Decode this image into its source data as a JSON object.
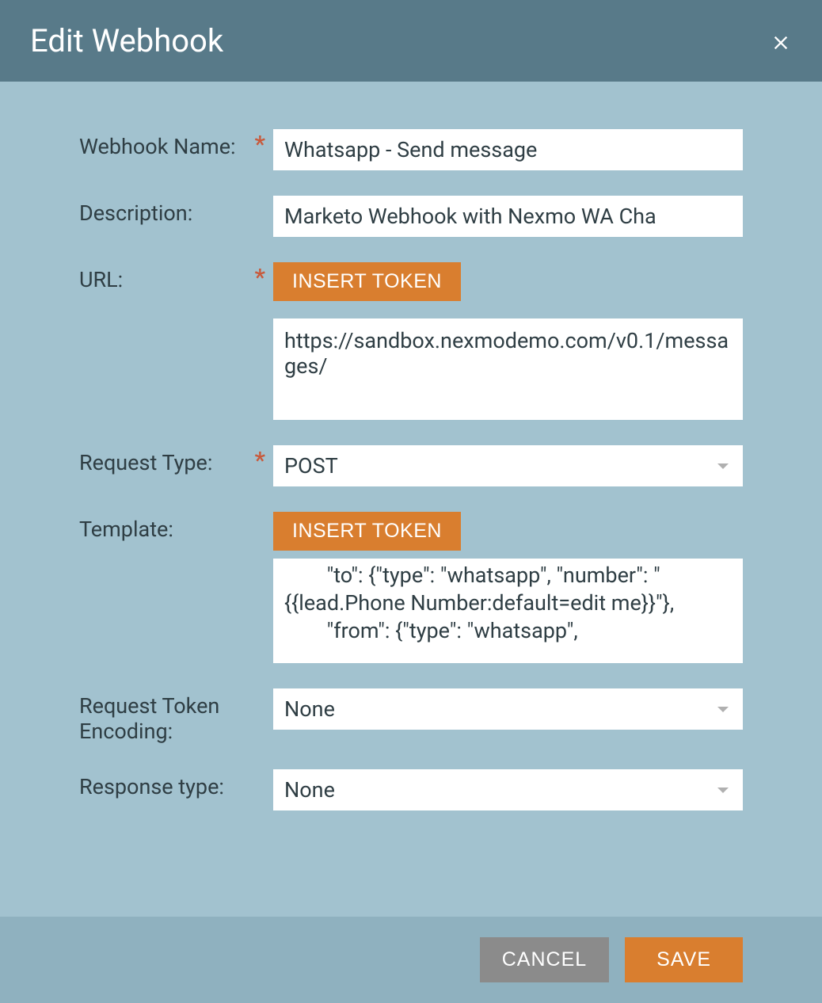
{
  "header": {
    "title": "Edit Webhook"
  },
  "form": {
    "webhookName": {
      "label": "Webhook Name:",
      "value": "Whatsapp - Send message",
      "required": true
    },
    "description": {
      "label": "Description:",
      "value": "Marketo Webhook with Nexmo WA Cha",
      "required": false
    },
    "url": {
      "label": "URL:",
      "insertTokenLabel": "INSERT TOKEN",
      "value": "https://sandbox.nexmodemo.com/v0.1/messages/",
      "required": true
    },
    "requestType": {
      "label": "Request Type:",
      "value": "POST",
      "required": true
    },
    "template": {
      "label": "Template:",
      "insertTokenLabel": "INSERT TOKEN",
      "value": "        \"to\": {\"type\": \"whatsapp\", \"number\": \"{{lead.Phone Number:default=edit me}}\"},\n        \"from\": {\"type\": \"whatsapp\",",
      "required": false
    },
    "requestTokenEncoding": {
      "label": "Request Token Encoding:",
      "value": "None",
      "required": false
    },
    "responseType": {
      "label": "Response type:",
      "value": "None",
      "required": false
    }
  },
  "footer": {
    "cancelLabel": "CANCEL",
    "saveLabel": "SAVE"
  },
  "requiredMarker": "*"
}
